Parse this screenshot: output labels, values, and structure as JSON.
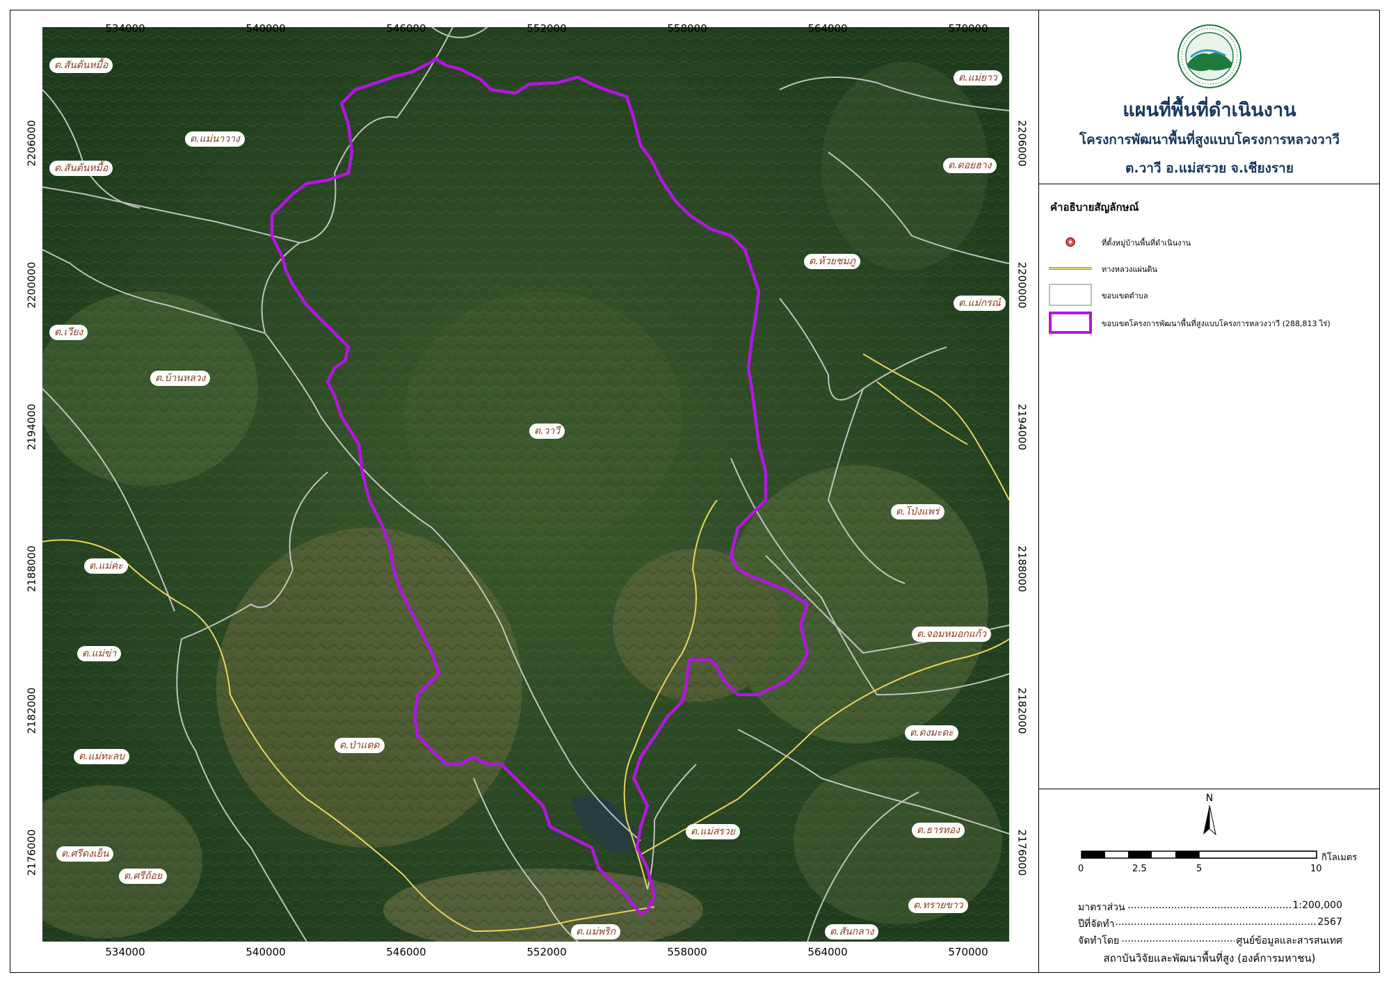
{
  "map": {
    "x_ticks": [
      "534000",
      "540000",
      "546000",
      "552000",
      "558000",
      "564000",
      "570000"
    ],
    "y_ticks": [
      "2206000",
      "2200000",
      "2194000",
      "2188000",
      "2182000",
      "2176000"
    ],
    "place_labels": [
      {
        "name": "ต.สันต้นหมื้อ"
      },
      {
        "name": "ต.แม่นาวาง"
      },
      {
        "name": "ต.สันต้นหมื้อ"
      },
      {
        "name": "ต.แม่ยาว"
      },
      {
        "name": "ต.ดอยฮาง"
      },
      {
        "name": "ต.ห้วยชมภู"
      },
      {
        "name": "ต.แม่กรณ์"
      },
      {
        "name": "ต.เวียง"
      },
      {
        "name": "ต.บ้านหลวง"
      },
      {
        "name": "ต.วาวี"
      },
      {
        "name": "ต.โป่งแพร่"
      },
      {
        "name": "ต.แม่คะ"
      },
      {
        "name": "ต.จอมหมอกแก้ว"
      },
      {
        "name": "ต.แม่ข่า"
      },
      {
        "name": "ต.ป่าแดด"
      },
      {
        "name": "ต.ดงมะดะ"
      },
      {
        "name": "ต.แม่ทะลบ"
      },
      {
        "name": "ต.แม่สรวย"
      },
      {
        "name": "ต.ธารทอง"
      },
      {
        "name": "ต.ศรีดงเย็น"
      },
      {
        "name": "ต.ศรีถ้อย"
      },
      {
        "name": "ต.ทรายขาว"
      },
      {
        "name": "ต.แม่พริก"
      },
      {
        "name": "ต.สันกลาง"
      }
    ],
    "colors": {
      "boundary": "#b316e0",
      "road": "#e8d45a",
      "subdistrict": "#d8d8d8",
      "forest_dark": "#1f3d1c",
      "forest_light": "#4a6435",
      "label_text": "#8b3a1a"
    }
  },
  "panel": {
    "title": "แผนที่พื้นที่ดำเนินงาน",
    "subtitle1": "โครงการพัฒนาพื้นที่สูงแบบโครงการหลวงวาวี",
    "subtitle2": "ต.วาวี อ.แม่สรวย จ.เชียงราย",
    "legend_title": "คำอธิบายสัญลักษณ์",
    "legend": [
      {
        "label": "ที่ตั้งหมู่บ้านพื้นที่ดำเนินงาน",
        "icon": "village-marker-icon"
      },
      {
        "label": "ทางหลวงแผ่นดิน",
        "icon": "highway-line-icon"
      },
      {
        "label": "ขอบเขตตำบล",
        "icon": "subdistrict-boundary-icon"
      },
      {
        "label": "ขอบเขตโครงการพัฒนาพื้นที่สูงแบบโครงการหลวงวาวี (288,813 ไร่)",
        "icon": "project-boundary-icon"
      }
    ],
    "north_label": "N",
    "scale_ticks": [
      "0",
      "2.5",
      "5",
      "10"
    ],
    "scale_unit": "กิโลเมตร",
    "info": [
      {
        "label": "มาตราส่วน",
        "value": "1:200,000"
      },
      {
        "label": "ปีที่จัดทำ",
        "value": "2567"
      },
      {
        "label": "จัดทำโดย",
        "value": "ศูนย์ข้อมูลและสารสนเทศ"
      }
    ],
    "institute": "สถาบันวิจัยและพัฒนาพื้นที่สูง (องค์การมหาชน)"
  }
}
